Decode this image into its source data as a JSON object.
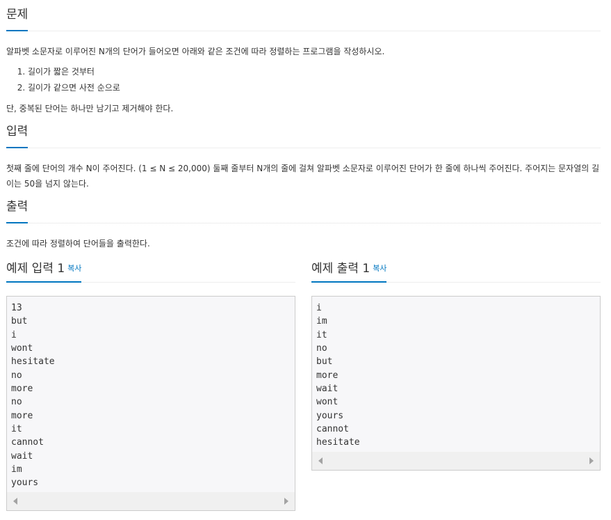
{
  "problem": {
    "title": "문제",
    "description": "알파벳 소문자로 이루어진 N개의 단어가 들어오면 아래와 같은 조건에 따라 정렬하는 프로그램을 작성하시오.",
    "conditions": [
      "길이가 짧은 것부터",
      "길이가 같으면 사전 순으로"
    ],
    "note": "단, 중복된 단어는 하나만 남기고 제거해야 한다."
  },
  "input": {
    "title": "입력",
    "description": "첫째 줄에 단어의 개수 N이 주어진다. (1 ≤ N ≤ 20,000) 둘째 줄부터 N개의 줄에 걸쳐 알파벳 소문자로 이루어진 단어가 한 줄에 하나씩 주어진다. 주어지는 문자열의 길이는 50을 넘지 않는다."
  },
  "output": {
    "title": "출력",
    "description": "조건에 따라 정렬하여 단어들을 출력한다."
  },
  "samples": {
    "input": {
      "title": "예제 입력 1",
      "copy_label": "복사",
      "content": "13\nbut\ni\nwont\nhesitate\nno\nmore\nno\nmore\nit\ncannot\nwait\nim\nyours"
    },
    "output": {
      "title": "예제 출력 1",
      "copy_label": "복사",
      "content": "i\nim\nit\nno\nbut\nmore\nwait\nwont\nyours\ncannot\nhesitate"
    }
  }
}
